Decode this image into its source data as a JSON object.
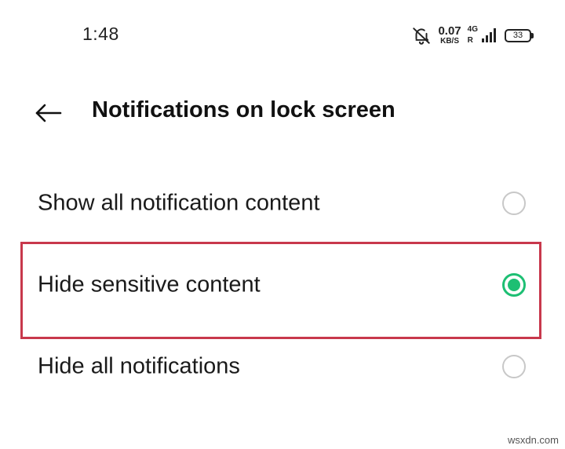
{
  "status_bar": {
    "time": "1:48",
    "net_speed_value": "0.07",
    "net_speed_unit": "KB/S",
    "network_type": "4G",
    "roaming": "R",
    "battery": "33",
    "icons": [
      "notifications-muted-icon",
      "signal-icon",
      "battery-icon"
    ]
  },
  "header": {
    "back_icon": "arrow-left-icon",
    "title": "Notifications on lock screen"
  },
  "options": [
    {
      "label": "Show all notification content",
      "selected": false
    },
    {
      "label": "Hide sensitive content",
      "selected": true
    },
    {
      "label": "Hide all notifications",
      "selected": false
    }
  ],
  "colors": {
    "accent": "#1dbf73",
    "highlight": "#c8384c",
    "radio_off": "#c8c8c8"
  },
  "watermark": "wsxdn.com"
}
